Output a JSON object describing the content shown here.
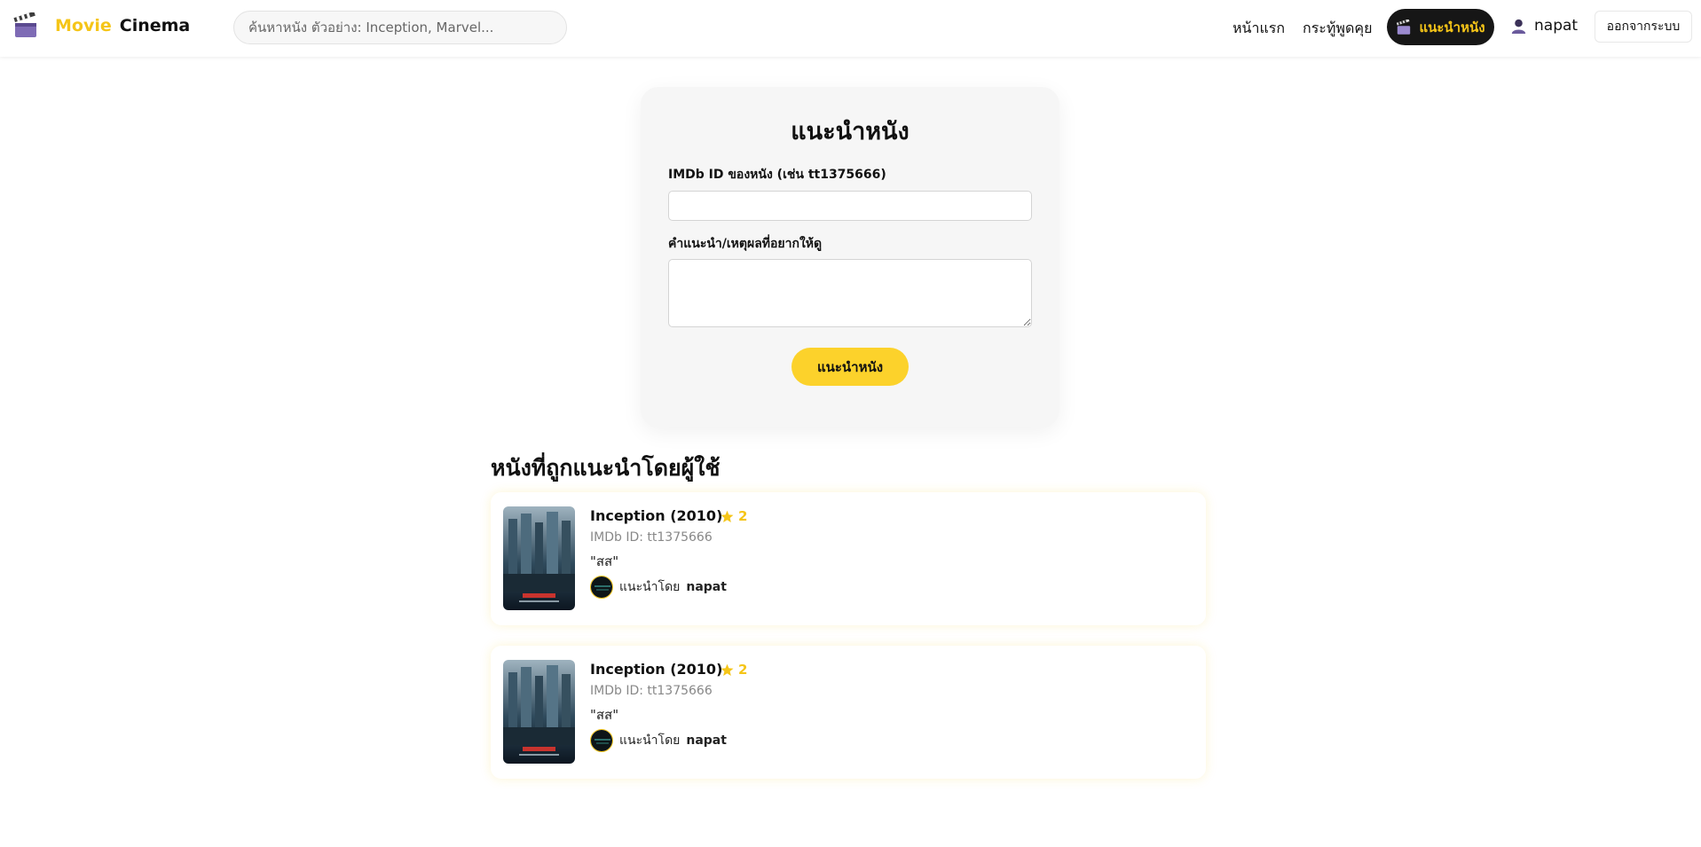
{
  "header": {
    "brand_movie": "Movie",
    "brand_cinema": "Cinema",
    "search_placeholder": "ค้นหาหนัง ตัวอย่าง: Inception, Marvel...",
    "nav_home": "หน้าแรก",
    "nav_board": "กระทู้พูดคุย",
    "nav_recommend": "แนะนำหนัง",
    "username": "napat",
    "logout_label": "ออกจากระบบ"
  },
  "form": {
    "title": "แนะนำหนัง",
    "imdb_label": "IMDb ID ของหนัง (เช่น tt1375666)",
    "imdb_value": "",
    "reason_label": "คำแนะนำ/เหตุผลที่อยากให้ดู",
    "reason_value": "",
    "submit_label": "แนะนำหนัง"
  },
  "recommendations_section": {
    "title": "หนังที่ถูกแนะนำโดยผู้ใช้",
    "items": [
      {
        "title": "Inception (2010)",
        "rating": "2",
        "imdb_label": "IMDb ID: tt1375666",
        "comment": "\"สส\"",
        "by_prefix": "แนะนำโดย",
        "user": "napat"
      },
      {
        "title": "Inception (2010)",
        "rating": "2",
        "imdb_label": "IMDb ID: tt1375666",
        "comment": "\"สส\"",
        "by_prefix": "แนะนำโดย",
        "user": "napat"
      }
    ]
  },
  "colors": {
    "accent": "#f5c518",
    "button_yellow": "#fcd22b",
    "nav_active_bg": "#161616"
  },
  "icons": [
    "clapperboard-icon",
    "user-icon",
    "star-icon"
  ]
}
